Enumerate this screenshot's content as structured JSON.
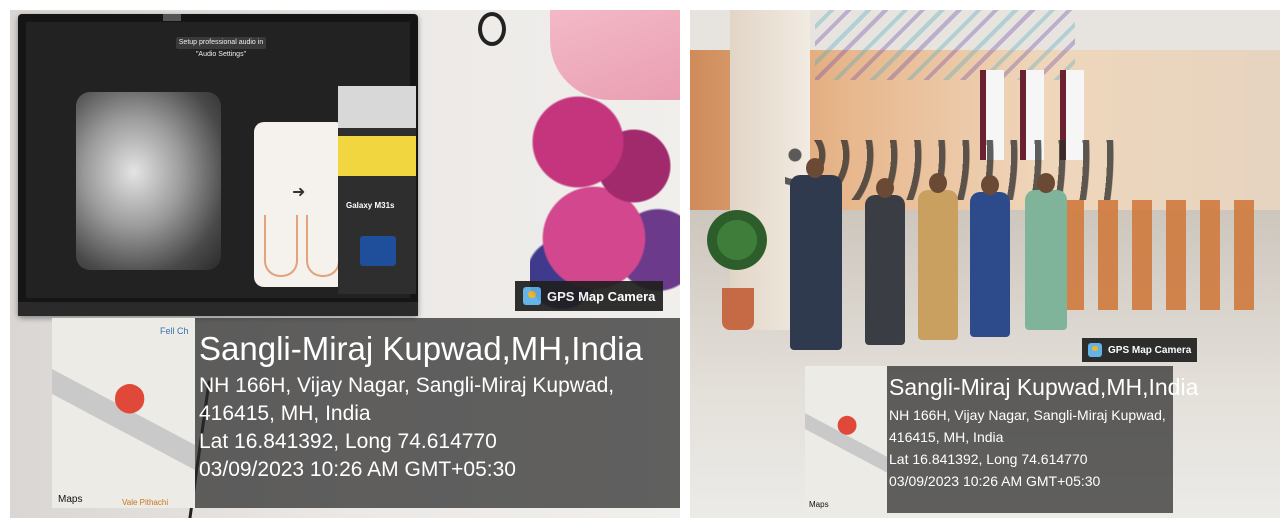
{
  "photos": [
    {
      "scene": {
        "screen_banner": "Setup professional audio in \"Audio Settings\"",
        "sidebar_caption": "Galaxy M31s"
      },
      "gps_overlay": {
        "badge": "GPS Map Camera",
        "map_logo": "Maps",
        "map_label_bottom": "Vale Pithachi",
        "map_label_corner": "Fell Ch",
        "title": "Sangli-Miraj Kupwad,MH,India",
        "address_line1": "NH 166H, Vijay Nagar, Sangli-Miraj Kupwad,",
        "address_line2": "416415, MH, India",
        "coordinates": "Lat 16.841392, Long 74.614770",
        "datetime": "03/09/2023 10:26 AM GMT+05:30"
      }
    },
    {
      "gps_overlay": {
        "badge": "GPS Map Camera",
        "map_logo": "Maps",
        "title": "Sangli-Miraj Kupwad,MH,India",
        "address_line1": "NH 166H, Vijay Nagar, Sangli-Miraj Kupwad,",
        "address_line2": "416415, MH, India",
        "coordinates": "Lat 16.841392, Long 74.614770",
        "datetime": "03/09/2023 10:26 AM GMT+05:30"
      }
    }
  ],
  "colors": {
    "overlay_background": "#282828",
    "map_pin": "#e0483a",
    "wall_orange": "#cf8b5a"
  }
}
